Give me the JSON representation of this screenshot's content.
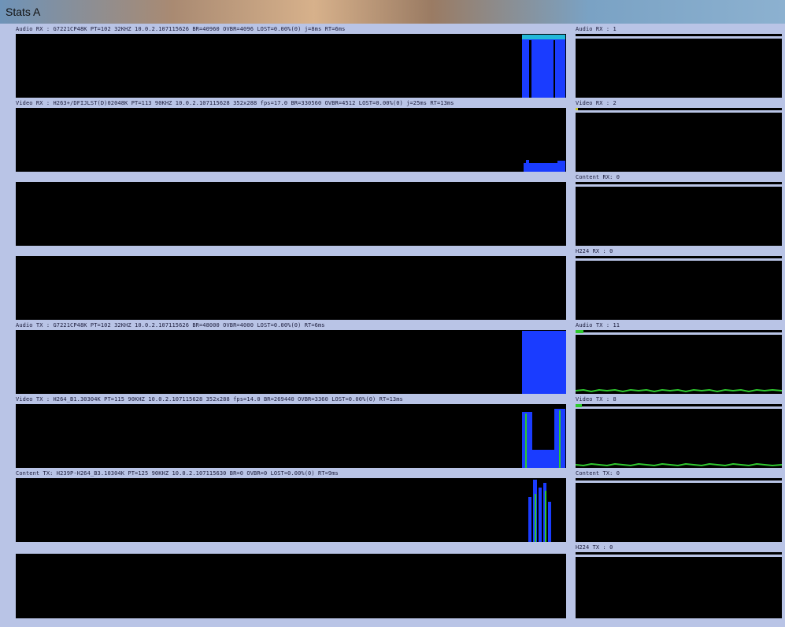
{
  "window": {
    "title": "Stats A"
  },
  "main_panels": [
    {
      "label": "Audio RX  : G7221CP48K PT=102 32KHZ 10.0.2.107115626 BR=40960 OVBR=4096 LOST=0.00%(0) j=8ms RT=6ms"
    },
    {
      "label": "Video RX  : H263+/DFIJLST(D)02048K PT=113 90KHZ 10.0.2.107115628 352x288 fps=17.0 BR=330560 OVBR=4512 LOST=0.00%(0) j=25ms RT=13ms"
    },
    {
      "label": ""
    },
    {
      "label": ""
    },
    {
      "label": "Audio TX  : G7221CP48K PT=102 32KHZ 10.0.2.107115626 BR=48000 OVBR=4000 LOST=0.00%(0) RT=6ms"
    },
    {
      "label": "Video TX  : H264_B1.30304K PT=115 90KHZ 10.0.2.107115628 352x288 fps=14.0 BR=269440 OVBR=3360 LOST=0.00%(0) RT=13ms"
    },
    {
      "label": "Content TX: H239P-H264_B3.10304K PT=125 90KHZ 10.0.2.107115630 BR=0 OVBR=0 LOST=0.00%(0) RT=9ms"
    },
    {
      "label": ""
    }
  ],
  "side_panels": [
    {
      "label": "Audio RX  : 1"
    },
    {
      "label": "Video RX  : 2"
    },
    {
      "label": "Content RX: 0"
    },
    {
      "label": "H224 RX   : 0"
    },
    {
      "label": "Audio TX  : 11"
    },
    {
      "label": "Video TX  : 8"
    },
    {
      "label": "Content TX: 0"
    },
    {
      "label": "H224 TX   : 0"
    }
  ],
  "colors": {
    "background": "#b9c4e6",
    "plot": "#000000",
    "blue": "#1a3cff",
    "cyan": "#22b8d8",
    "green": "#2fc92f"
  }
}
